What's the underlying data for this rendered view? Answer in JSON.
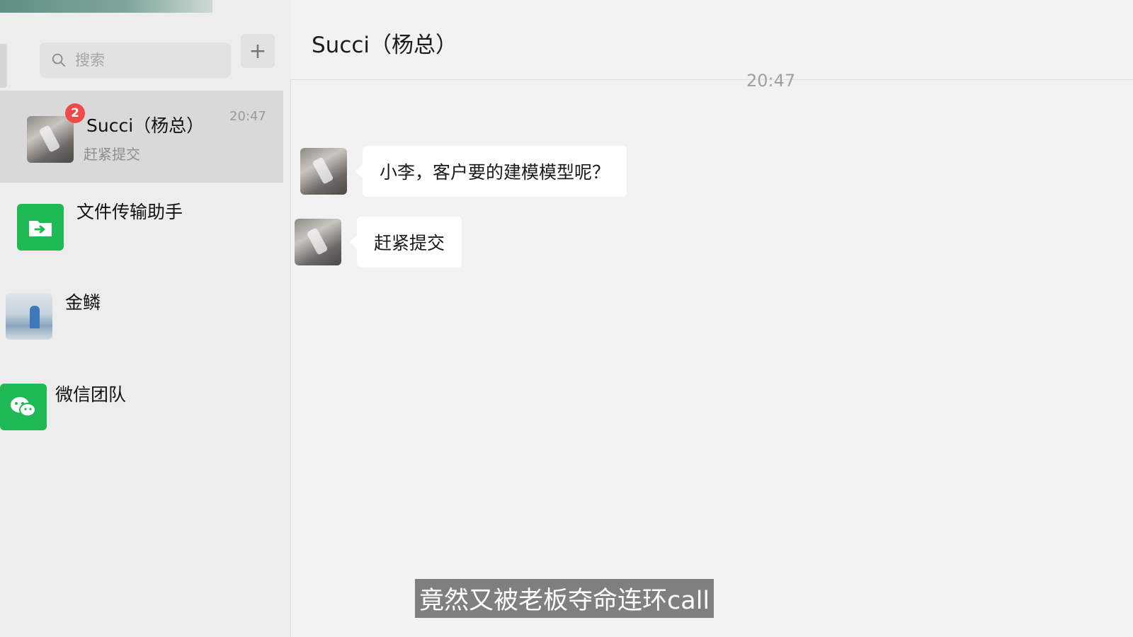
{
  "search": {
    "placeholder": "搜索",
    "add_label": "+"
  },
  "chats": [
    {
      "name": "Succi（杨总）",
      "preview": "赶紧提交",
      "time": "20:47",
      "unread": "2",
      "avatar": "bottle-photo"
    },
    {
      "name": "文件传输助手",
      "preview": "",
      "time": "",
      "avatar": "file-transfer-icon"
    },
    {
      "name": "金鳞",
      "preview": "",
      "time": "",
      "avatar": "street-photo"
    },
    {
      "name": "微信团队",
      "preview": "",
      "time": "",
      "avatar": "wechat-icon"
    }
  ],
  "conversation": {
    "title": "Succi（杨总）",
    "timestamp": "20:47",
    "messages": [
      {
        "text": "小李，客户要的建模模型呢？"
      },
      {
        "text": "赶紧提交"
      }
    ]
  },
  "subtitle": "竟然又被老板夺命连环call",
  "colors": {
    "accent_green": "#1fb955",
    "badge_red": "#f04a4a",
    "bubble": "#ffffff"
  }
}
